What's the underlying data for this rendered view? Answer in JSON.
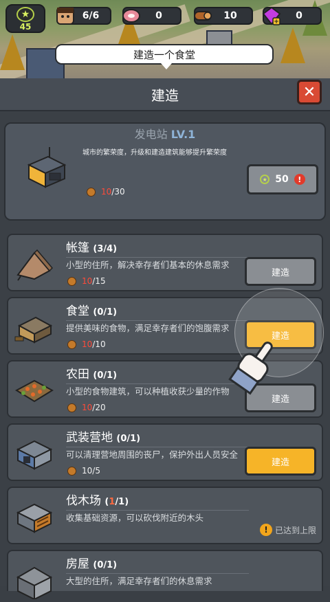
{
  "hud": {
    "level": "45",
    "survivors": "6/6",
    "meat": "0",
    "wood": "10",
    "gems": "0"
  },
  "tooltip": "建造一个食堂",
  "panel": {
    "title": "建造",
    "close_icon": "close-icon"
  },
  "featured": {
    "name": "发电站",
    "level": "LV.1",
    "description": "城市的繁荣度，升级和建造建筑能够提升繁荣度",
    "wood_current": "10",
    "wood_max": "/30",
    "cost": "50"
  },
  "buildings": [
    {
      "name": "帐篷",
      "count": "(3/4)",
      "desc": "小型的住所，解决幸存者们基本的休息需求",
      "wood_current": "10",
      "wood_max": "/15",
      "button": "建造"
    },
    {
      "name": "食堂",
      "count": "(0/1)",
      "desc": "提供美味的食物，满足幸存者们的饱腹需求",
      "wood_current": "10",
      "wood_max": "/10",
      "button": "建造"
    },
    {
      "name": "农田",
      "count": "(0/1)",
      "desc": "小型的食物建筑，可以种植收获少量的作物",
      "wood_current": "10",
      "wood_max": "/20",
      "button": "建造"
    },
    {
      "name": "武装营地",
      "count": "(0/1)",
      "desc": "可以清理营地周围的丧尸，保护外出人员安全",
      "wood_current": "10",
      "wood_max": "/5",
      "button": "建造"
    },
    {
      "name": "伐木场",
      "count_open": "(",
      "count_hi": "1",
      "count_close": "/1)",
      "desc": "收集基础资源，可以砍伐附近的木头",
      "status": "已达到上限"
    },
    {
      "name": "房屋",
      "count": "(0/1)",
      "desc": "大型的住所，满足幸存者们的休息需求"
    }
  ],
  "colors": {
    "accent": "#f6b428",
    "danger": "#e23a2a",
    "panel": "#3b4046",
    "card": "#4f555c"
  }
}
